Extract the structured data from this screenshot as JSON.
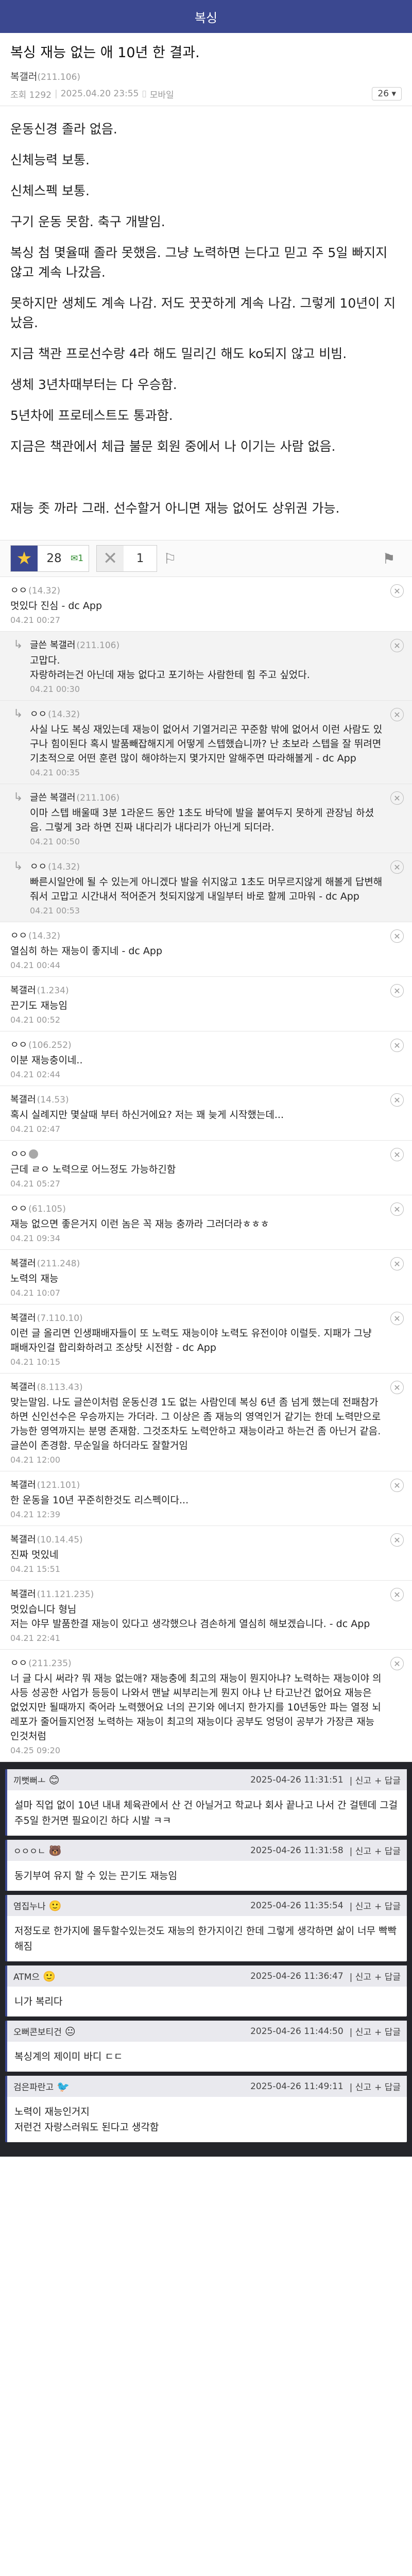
{
  "header": {
    "title": "복싱"
  },
  "post": {
    "title": "복싱 재능 없는 애 10년 한 결과.",
    "author": "복갤러",
    "author_ip": "(211.106)",
    "views": "조회 1292",
    "datetime": "2025.04.20 23:55",
    "device_icon": "mobile-icon",
    "device": "모바일",
    "reply_count": "26",
    "body": [
      "운동신경 졸라 없음.",
      "신체능력 보통.",
      "신체스펙 보통.",
      "구기 운동 못함. 축구 개발임.",
      "복싱 첨 몇율때 졸라 못했음. 그냥 노력하면 는다고 믿고 주 5일 빠지지 않고 계속 나갔음.",
      "못하지만 생체도 계속 나감. 저도 꿋꿋하게 계속 나감. 그렇게 10년이 지났음.",
      "지금 책관 프로선수랑 4라 해도 밀리긴 해도 ko되지 않고 비빔.",
      "생체 3년차때부터는 다 우승함.",
      "5년차에 프로테스트도 통과함.",
      "지금은 책관에서 체급 불문 회원 중에서 나 이기는 사람 없음.",
      "",
      "재능 좃 까라 그래. 선수할거 아니면 재능 없어도 상위권 가능."
    ]
  },
  "votes": {
    "up": "28",
    "up_sub": "1",
    "down": "1"
  },
  "comments": [
    {
      "reply": false,
      "nick": "ㅇㅇ",
      "ip": "(14.32)",
      "badge": false,
      "text": "멋있다 진심 - dc App",
      "date": "04.21 00:27"
    },
    {
      "reply": true,
      "nick": "글쓴 복갤러",
      "ip": "(211.106)",
      "badge": false,
      "text": "고맙다.\n자랑하려는건 아닌데 재능 없다고 포기하는 사람한테 힘 주고 싶었다.",
      "date": "04.21 00:30"
    },
    {
      "reply": true,
      "nick": "ㅇㅇ",
      "ip": "(14.32)",
      "badge": false,
      "text": "사실 나도 복싱 재있는데 재능이 없어서 기열거리곤 꾸준함 밖에 없어서 이런 사람도 있구나 힘이된다 혹시 발품빼잡해지게 어떻게 스텝했습니까? 난 초보라 스텝을 잘 뛰려면 기초적으로 어떤 훈련 많이 해야하는지 몇가지만 알해주면 따라해볼게 - dc App",
      "date": "04.21 00:35"
    },
    {
      "reply": true,
      "nick": "글쓴 복갤러",
      "ip": "(211.106)",
      "badge": false,
      "text": "이마 스텝 배울때 3분 1라운드 동안 1초도 바닥에 발을 붙여두지 못하게 관장님 하셨음. 그렇게 3라 하면 진짜 내다리가 내다리가 아닌게 되더라.",
      "date": "04.21 00:50"
    },
    {
      "reply": true,
      "nick": "ㅇㅇ",
      "ip": "(14.32)",
      "badge": false,
      "text": "빠른시일안에 될 수 있는게 아니겠다 발을 쉬지않고 1초도 머무르지않게 해볼게 답변해줘서 고맙고 시간내서 적어준거 첫되지않게 내일부터 바로 할께 고마워 - dc App",
      "date": "04.21 00:53"
    },
    {
      "reply": false,
      "nick": "ㅇㅇ",
      "ip": "(14.32)",
      "badge": false,
      "text": "열심히 하는 재능이 좋지네 - dc App",
      "date": "04.21 00:44"
    },
    {
      "reply": false,
      "nick": "복갤러",
      "ip": "(1.234)",
      "badge": false,
      "text": "끈기도 재능임",
      "date": "04.21 00:52"
    },
    {
      "reply": false,
      "nick": "ㅇㅇ",
      "ip": "(106.252)",
      "badge": false,
      "text": "이분 재능충이네..",
      "date": "04.21 02:44"
    },
    {
      "reply": false,
      "nick": "복갤러",
      "ip": "(14.53)",
      "badge": false,
      "text": "혹시 실례지만 몇살때 부터 하신거에요? 저는 꽤 늦게 시작했는데...",
      "date": "04.21 02:47"
    },
    {
      "reply": false,
      "nick": "ㅇㅇ",
      "ip": "",
      "badge": true,
      "text": "근데 ㄹㅇ 노력으로 어느정도 가능하긴함",
      "date": "04.21 05:27"
    },
    {
      "reply": false,
      "nick": "ㅇㅇ",
      "ip": "(61.105)",
      "badge": false,
      "text": "재능 없으면 좋은거지 이런 놈은 꼭 재능 충까라 그러더라ㅎㅎㅎ",
      "date": "04.21 09:34"
    },
    {
      "reply": false,
      "nick": "복갤러",
      "ip": "(211.248)",
      "badge": false,
      "text": "노력의 재능",
      "date": "04.21 10:07"
    },
    {
      "reply": false,
      "nick": "복갤러",
      "ip": "(7.110.10)",
      "badge": false,
      "text": "이런 글 올리면 인생패배자들이 또 노력도 재능이야 노력도 유전이야 이럴듯. 지패가 그냥 패배자인걸 합리화하려고 조상탓 시전함 - dc App",
      "date": "04.21 10:15"
    },
    {
      "reply": false,
      "nick": "복갤러",
      "ip": "(8.113.43)",
      "badge": false,
      "text": "맞는말임. 나도 글쓴이처럼 운동신경 1도 없는 사람인데 복싱 6년 좀 넘게 했는데 전패참가하면 신인선수은 우승까지는 가더라. 그 이상은 좀 재능의 영역인거 같기는 한데 노력만으로 가능한 영역까지는 분명 존재함. 그것조차도 노력안하고 재능이라고 하는건 좀 아닌거 같음. 글쓴이 존경함. 무순일을 하더라도 잘할거임",
      "date": "04.21 12:00"
    },
    {
      "reply": false,
      "nick": "복갤러",
      "ip": "(121.101)",
      "badge": false,
      "text": "한 운동을 10년 꾸준히한것도 리스펙이다...",
      "date": "04.21 12:39"
    },
    {
      "reply": false,
      "nick": "복갤러",
      "ip": "(10.14.45)",
      "badge": false,
      "text": "진짜 멋있네",
      "date": "04.21 15:51"
    },
    {
      "reply": false,
      "nick": "복갤러",
      "ip": "(11.121.235)",
      "badge": false,
      "text": "멋있습니다 형님\n저는 야무 발품한결 재능이 있다고 생각했으나 겸손하게 열심히 해보겠습니다. - dc App",
      "date": "04.21 22:41"
    },
    {
      "reply": false,
      "nick": "ㅇㅇ",
      "ip": "(211.235)",
      "badge": false,
      "text": "너 글 다시 써라? 뭐 재능 없는애? 재능충에 최고의 재능이 뭔지아냐? 노력하는 재능이야 의사등 성공한 사업가 등등이 나와서 맨날 씨부리는게 뭔지 아냐 난 타고난건 없어요 재능은 없었지만 될때까지 죽어라 노력했어요 너의 끈기와 에너지 한가지를 10년동안 파는 열정 뇌레포가 줄어들지언정 노력하는 재능이 최고의 재능이다 공부도 엉덩이 공부가 가장큰 재능인것처럼",
      "date": "04.25 09:20"
    }
  ],
  "dark_comments": [
    {
      "nick": "끼뻣뻐ㅗ",
      "face": "😊",
      "time": "2025-04-26 11:31:51",
      "report": "신고",
      "reply": "답글",
      "text": "설마 직업 없이 10년 내내 체육관에서 산 건 아닐거고 학교나 회사 끝나고 나서 간 걸텐데 그걸 주5일 한거면 필요이긴 하다 시발 ㅋㅋ"
    },
    {
      "nick": "ㅇㅇㅇㄴ",
      "face": "🐻",
      "time": "2025-04-26 11:31:58",
      "report": "신고",
      "reply": "답글",
      "text": "동기부여 유지 할 수 있는 끈기도 재능임"
    },
    {
      "nick": "염집누나",
      "face": "🙂",
      "time": "2025-04-26 11:35:54",
      "report": "신고",
      "reply": "답글",
      "text": "저정도로 한가지에 몰두할수있는것도 재능의 한가지이긴 한데 그렇게 생각하면 삶이 너무 빡빡해짐"
    },
    {
      "nick": "ATM으",
      "face": "🙂",
      "time": "2025-04-26 11:36:47",
      "report": "신고",
      "reply": "답글",
      "text": "니가 복리다"
    },
    {
      "nick": "오뻐콘보티건",
      "face": "😐",
      "time": "2025-04-26 11:44:50",
      "report": "신고",
      "reply": "답글",
      "text": "복싱계의 제이미 바디 ㄷㄷ"
    },
    {
      "nick": "검은파란고",
      "face": "🐦",
      "time": "2025-04-26 11:49:11",
      "report": "신고",
      "reply": "답글",
      "text": "노력이 재능인거지\n저런건 자랑스러워도 된다고 생각함"
    }
  ]
}
